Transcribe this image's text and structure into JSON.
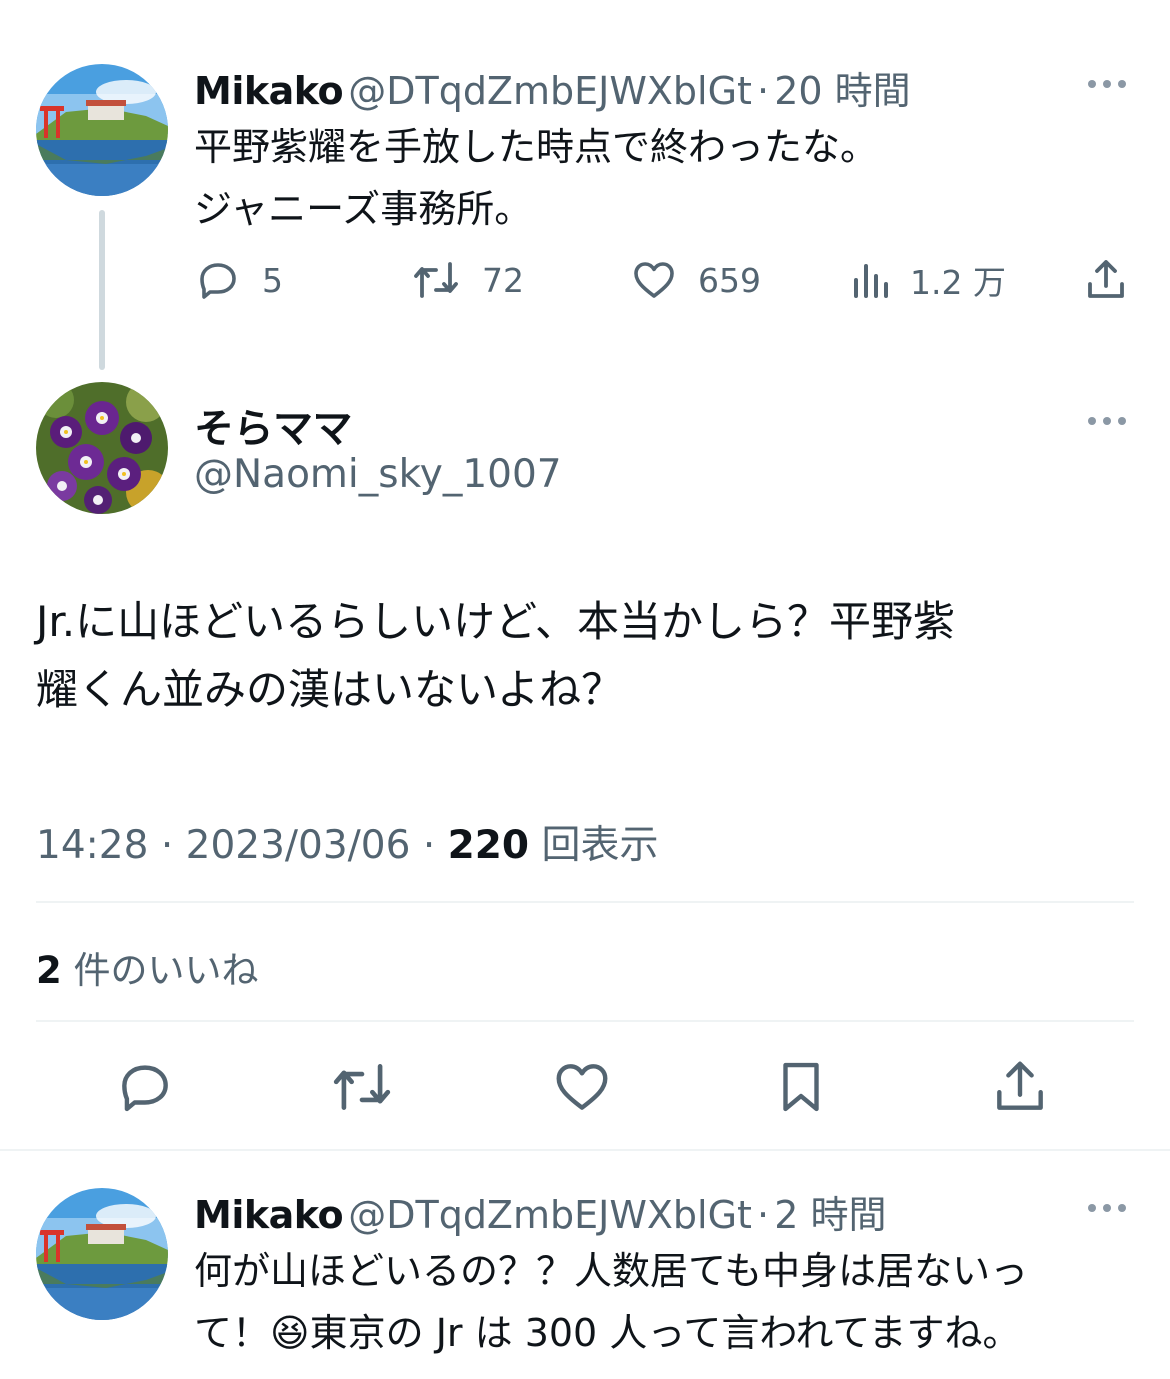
{
  "reply_parent": {
    "display_name": "Mikako",
    "handle": "@DTqdZmbEJWXblGt",
    "time": "20 時間",
    "lines": [
      "平野紫耀を手放した時点で終わったな。",
      "ジャニーズ事務所。"
    ],
    "replies": "5",
    "retweets": "72",
    "likes": "659",
    "views": "1.2 万"
  },
  "main_tweet": {
    "display_name": "そらママ",
    "handle": "@Naomi_sky_1007",
    "lines": [
      "Jr.に山ほどいるらしいけど、本当かしら？平野紫",
      "耀くん並みの漢はいないよね？"
    ],
    "time": "14:28",
    "date": "2023/03/06",
    "view_count": "220",
    "view_label": "回表示",
    "likes_count": "2",
    "likes_label": "件のいいね"
  },
  "reply": {
    "display_name": "Mikako",
    "handle": "@DTqdZmbEJWXblGt",
    "time": "2 時間",
    "line1": "何が山ほどいるの？？人数居ても中身は居ないっ",
    "line2_a": "て！",
    "emoji": "😆",
    "line2_b": "東京の Jr は 300 人って言われてますね。"
  },
  "separators": {
    "dot": "·"
  },
  "icons": {
    "reply": "reply-icon",
    "retweet": "retweet-icon",
    "like": "heart-icon",
    "views": "views-icon",
    "share": "share-icon",
    "bookmark": "bookmark-icon",
    "more": "more-icon"
  },
  "colors": {
    "text": "#0f1419",
    "secondary": "#536471",
    "divider": "#eff3f4",
    "thread_line": "#cfd9de"
  }
}
